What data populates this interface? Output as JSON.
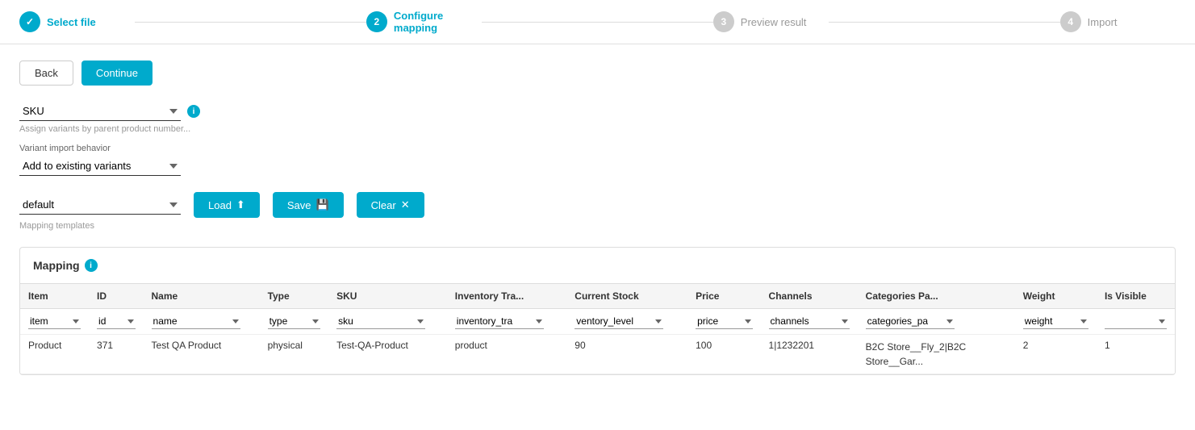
{
  "stepper": {
    "steps": [
      {
        "number": "✓",
        "label": "Select file",
        "state": "done"
      },
      {
        "number": "2",
        "label": "Configure mapping",
        "state": "active"
      },
      {
        "number": "3",
        "label": "Preview result",
        "state": "inactive"
      },
      {
        "number": "4",
        "label": "Import",
        "state": "inactive"
      }
    ]
  },
  "buttons": {
    "back": "Back",
    "continue": "Continue",
    "load": "Load",
    "save": "Save",
    "clear": "Clear"
  },
  "sku_dropdown": {
    "value": "SKU",
    "hint": "Assign variants by parent product number..."
  },
  "variant_behavior": {
    "label": "Variant import behavior",
    "value": "Add to existing variants"
  },
  "template_select": {
    "value": "default"
  },
  "template_label": "Mapping templates",
  "mapping": {
    "title": "Mapping",
    "columns": [
      "Item",
      "ID",
      "Name",
      "Type",
      "SKU",
      "Inventory Tra...",
      "Current Stock",
      "Price",
      "Channels",
      "Categories Pa...",
      "Weight",
      "Is Visible"
    ],
    "dropdowns": [
      "item",
      "id",
      "name",
      "type",
      "sku",
      "inventory_tra",
      "ventory_level",
      "price",
      "channels",
      "categories_pa",
      "weight",
      ""
    ],
    "rows": [
      {
        "item": "Product",
        "id": "371",
        "name": "Test QA Product",
        "type": "physical",
        "sku": "Test-QA-Product",
        "inventory_tracking": "product",
        "current_stock": "90",
        "price": "100",
        "channels": "1|1232201",
        "categories": "B2C Store__Fly_2|B2C Store__Gar...",
        "weight": "2",
        "is_visible": "1"
      }
    ]
  },
  "info_icon_label": "i"
}
